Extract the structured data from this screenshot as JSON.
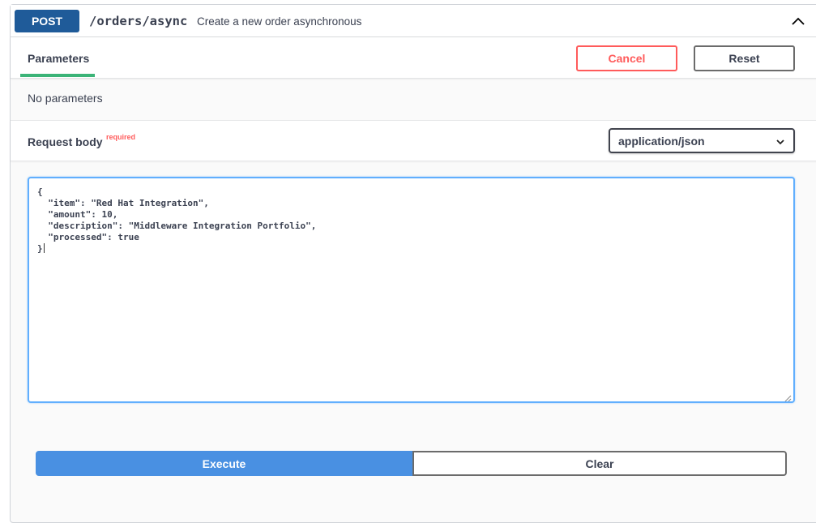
{
  "operation": {
    "method": "POST",
    "path": "/orders/async",
    "summary": "Create a new order asynchronous",
    "method_color": "#1f5b99"
  },
  "tabs": {
    "parameters_label": "Parameters",
    "active_color": "#3cb478"
  },
  "actions": {
    "cancel_label": "Cancel",
    "reset_label": "Reset",
    "cancel_color": "#ff5b5b"
  },
  "parameters": {
    "empty_text": "No parameters"
  },
  "request_body": {
    "title": "Request body",
    "required_label": "required",
    "content_type": "application/json",
    "editor_lines": [
      "{",
      "  \"item\": \"Red Hat Integration\",",
      "  \"amount\": 10,",
      "  \"description\": \"Middleware Integration Portfolio\",",
      "  \"processed\": true",
      "}"
    ]
  },
  "execute": {
    "execute_label": "Execute",
    "clear_label": "Clear",
    "execute_color": "#4990e2"
  },
  "icons": {
    "collapse": "chevron-up-icon",
    "select": "chevron-down-icon",
    "resize": "resize-handle-icon"
  }
}
